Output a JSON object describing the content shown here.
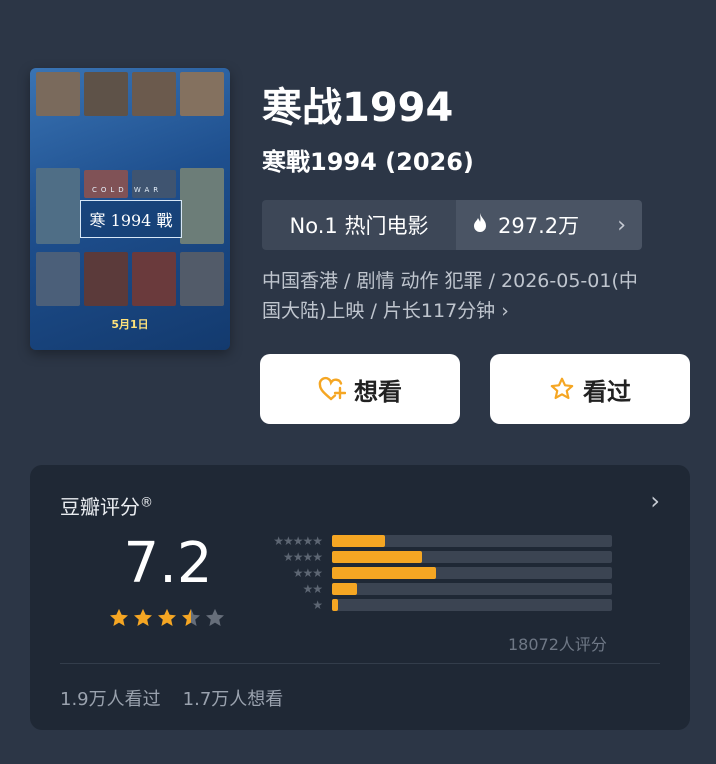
{
  "movie": {
    "title": "寒战1994",
    "original_title": "寒戰1994 (2026)",
    "poster": {
      "title_text": "寒 1994 戰",
      "english_text": "COLD WAR",
      "date_text": "5月1日"
    },
    "rank_label": "No.1 热门电影",
    "heat_value": "297.2万",
    "meta_line1": "中国香港 / 剧情 动作 犯罪 / 2026-05-01(中",
    "meta_line2": "国大陆)上映 / 片长117分钟 ›"
  },
  "actions": {
    "want_label": "想看",
    "seen_label": "看过"
  },
  "rating": {
    "title": "豆瓣评分",
    "registered_mark": "®",
    "score": "7.2",
    "stars_filled": 3.5,
    "histogram": [
      {
        "stars": 5,
        "fraction": 0.19
      },
      {
        "stars": 4,
        "fraction": 0.32
      },
      {
        "stars": 3,
        "fraction": 0.37
      },
      {
        "stars": 2,
        "fraction": 0.09
      },
      {
        "stars": 1,
        "fraction": 0.02
      }
    ],
    "count_text": "18072人评分",
    "seen_text": "1.9万人看过",
    "want_text": "1.7万人想看"
  },
  "colors": {
    "background": "#2c3646",
    "card": "#1f2835",
    "accent_orange": "#f5a623",
    "star_empty": "#666e7a"
  },
  "icons": {
    "heat": "flame-icon",
    "want": "heart-plus-icon",
    "seen": "star-outline-icon",
    "chevron": "chevron-right-icon"
  }
}
